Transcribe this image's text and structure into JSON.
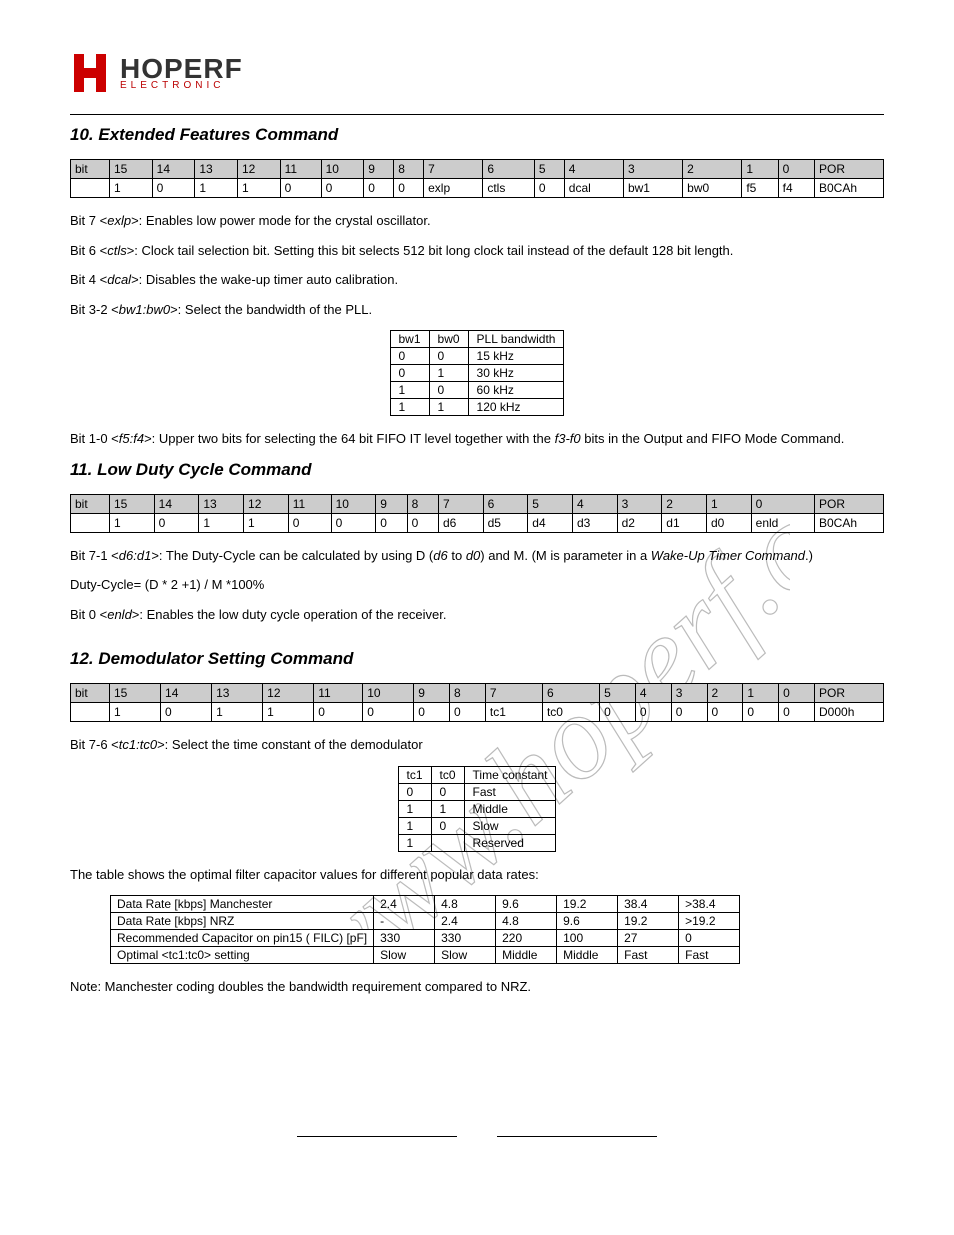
{
  "logo": {
    "main": "HOPERF",
    "sub": "ELECTRONIC"
  },
  "section10": {
    "heading": "10. Extended Features Command",
    "bit_table": {
      "headers": [
        "bit",
        "15",
        "14",
        "13",
        "12",
        "11",
        "10",
        "9",
        "8",
        "7",
        "6",
        "5",
        "4",
        "3",
        "2",
        "1",
        "0",
        "POR"
      ],
      "row": [
        "",
        "1",
        "0",
        "1",
        "1",
        "0",
        "0",
        "0",
        "0",
        "exlp",
        "ctls",
        "0",
        "dcal",
        "bw1",
        "bw0",
        "f5",
        "f4",
        "B0CAh"
      ]
    },
    "p1_pre": "Bit 7 <",
    "p1_it": "exlp",
    "p1_post": ">: Enables low power mode for the crystal oscillator.",
    "p2_pre": "Bit 6 <",
    "p2_it": "ctls",
    "p2_post": ">: Clock tail selection bit. Setting this bit selects 512 bit long clock tail instead of the default 128 bit length.",
    "p3_pre": "Bit 4 <",
    "p3_it": "dcal",
    "p3_post": ">: Disables the wake-up timer auto calibration.",
    "p4_pre": "Bit 3-2 <",
    "p4_it": "bw1:bw0",
    "p4_post": ">: Select the bandwidth of the PLL.",
    "bw_table": {
      "headers": [
        "bw1",
        "bw0",
        "PLL bandwidth"
      ],
      "rows": [
        [
          "0",
          "0",
          "15 kHz"
        ],
        [
          "0",
          "1",
          "30 kHz"
        ],
        [
          "1",
          "0",
          "60 kHz"
        ],
        [
          "1",
          "1",
          "120 kHz"
        ]
      ]
    },
    "p5_pre": "Bit 1-0 <",
    "p5_it": "f5:f4",
    "p5_mid": ">: Upper two bits for selecting the 64 bit FIFO IT level together with the ",
    "p5_it2": "f3-f0",
    "p5_post": " bits in the Output and FIFO Mode Command."
  },
  "section11": {
    "heading": "11. Low Duty Cycle Command",
    "bit_table": {
      "headers": [
        "bit",
        "15",
        "14",
        "13",
        "12",
        "11",
        "10",
        "9",
        "8",
        "7",
        "6",
        "5",
        "4",
        "3",
        "2",
        "1",
        "0",
        "POR"
      ],
      "row": [
        "",
        "1",
        "0",
        "1",
        "1",
        "0",
        "0",
        "0",
        "0",
        "d6",
        "d5",
        "d4",
        "d3",
        "d2",
        "d1",
        "d0",
        "enld",
        "B0CAh"
      ]
    },
    "p1_pre": "Bit 7-1 <",
    "p1_it": "d6:d1",
    "p1_mid": ">: The Duty-Cycle can be calculated by using D (",
    "p1_it2": "d6",
    "p1_mid2": " to ",
    "p1_it3": "d0",
    "p1_mid3": ") and M. (M is parameter in a ",
    "p1_it4": "Wake-Up Timer Command",
    "p1_post": ".)",
    "formula": "Duty-Cycle= (D * 2 +1) / M *100%",
    "p2_pre": "Bit 0 <",
    "p2_it": "enld",
    "p2_post": ">: Enables the low duty cycle operation of the receiver."
  },
  "section12": {
    "heading": "12. Demodulator Setting Command",
    "bit_table": {
      "headers": [
        "bit",
        "15",
        "14",
        "13",
        "12",
        "11",
        "10",
        "9",
        "8",
        "7",
        "6",
        "5",
        "4",
        "3",
        "2",
        "1",
        "0",
        "POR"
      ],
      "row": [
        "",
        "1",
        "0",
        "1",
        "1",
        "0",
        "0",
        "0",
        "0",
        "tc1",
        "tc0",
        "0",
        "0",
        "0",
        "0",
        "0",
        "0",
        "D000h"
      ]
    },
    "p1_pre": "Bit 7-6 <",
    "p1_it": "tc1:tc0",
    "p1_post": ">: Select the time constant of the demodulator",
    "tc_table": {
      "headers": [
        "tc1",
        "tc0",
        "Time constant"
      ],
      "rows": [
        [
          "0",
          "0",
          "Fast"
        ],
        [
          "1",
          "1",
          "Middle"
        ],
        [
          "1",
          "0",
          "Slow"
        ],
        [
          "1",
          "",
          "Reserved"
        ]
      ]
    },
    "p2": "The table shows the optimal filter capacitor values for different popular data rates:",
    "rate_table": {
      "rows": [
        [
          "Data Rate [kbps] Manchester",
          "2.4",
          "4.8",
          "9.6",
          "19.2",
          "38.4",
          ">38.4"
        ],
        [
          "Data Rate [kbps] NRZ",
          "-",
          "2.4",
          "4.8",
          "9.6",
          "19.2",
          ">19.2"
        ],
        [
          "Recommended Capacitor on pin15 ( FILC) [pF]",
          "330",
          "330",
          "220",
          "100",
          "27",
          "0"
        ],
        [
          "Optimal <tc1:tc0> setting",
          "Slow",
          "Slow",
          "Middle",
          "Middle",
          "Fast",
          "Fast"
        ]
      ]
    },
    "note": "Note: Manchester coding doubles the bandwidth requirement compared to NRZ."
  }
}
